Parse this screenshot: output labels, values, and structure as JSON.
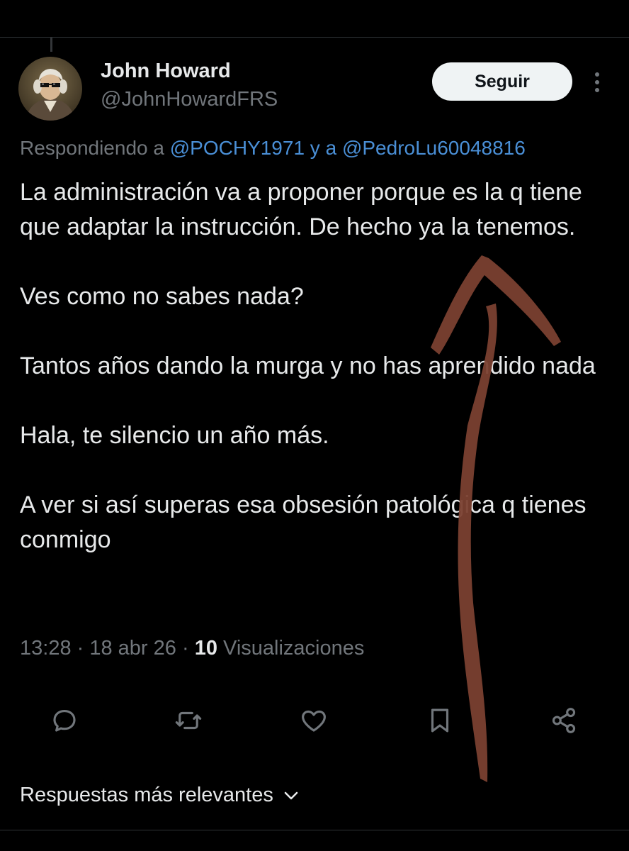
{
  "author": {
    "name": "John Howard",
    "handle": "@JohnHowardFRS"
  },
  "follow_button_label": "Seguir",
  "more_icon": "three-dots-vertical-icon",
  "replying": {
    "prefix": "Respondiendo a ",
    "mention1": "@POCHY1971",
    "conjunction": " y a ",
    "mention2": "@PedroLu60048816"
  },
  "tweet_paragraphs": [
    "La administración va a proponer porque es la q tiene que adaptar la instrucción. De hecho ya la tenemos.",
    "Ves como no sabes nada?",
    "Tantos años dando la murga y no has aprendido nada",
    "Hala, te silencio un año más.",
    "A ver si así superas esa obsesión patológica q tienes conmigo"
  ],
  "meta": {
    "time": "13:28",
    "separator": " · ",
    "date": "18 abr 26",
    "views_count": "10",
    "views_label": " Visualizaciones"
  },
  "action_icons": [
    "reply-icon",
    "retweet-icon",
    "like-icon",
    "bookmark-icon",
    "share-icon"
  ],
  "sort_label": "Respuestas más relevantes",
  "colors": {
    "background": "#000000",
    "text_primary": "#e7e9ea",
    "text_secondary": "#71767b",
    "mention": "#4a8fd6",
    "follow_button_bg": "#eff3f4",
    "arrow_overlay": "#7a4030"
  }
}
